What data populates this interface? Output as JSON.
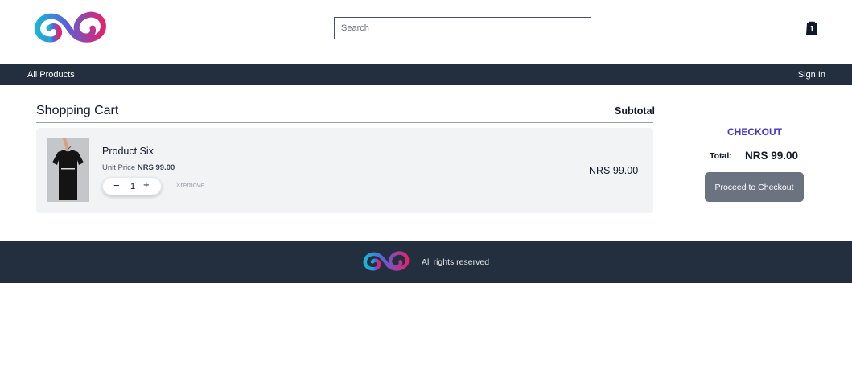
{
  "header": {
    "search_placeholder": "Search",
    "cart_count": "1"
  },
  "nav": {
    "all_products": "All Products",
    "sign_in": "Sign In"
  },
  "cart": {
    "title": "Shopping Cart",
    "subtotal_header": "Subtotal",
    "items": [
      {
        "name": "Product Six",
        "unit_price_label": "Unit Price",
        "unit_price": "NRS 99.00",
        "quantity": "1",
        "remove_label": "remove",
        "line_total": "NRS 99.00"
      }
    ]
  },
  "checkout": {
    "heading": "CHECKOUT",
    "total_label": "Total:",
    "total_value": "NRS 99.00",
    "button_label": "Proceed to Checkout"
  },
  "footer": {
    "text": "All rights reserved"
  },
  "colors": {
    "nav_bg": "#232f3e",
    "accent": "#4338ca",
    "button_bg": "#6b7280",
    "card_bg": "#f2f3f5"
  }
}
